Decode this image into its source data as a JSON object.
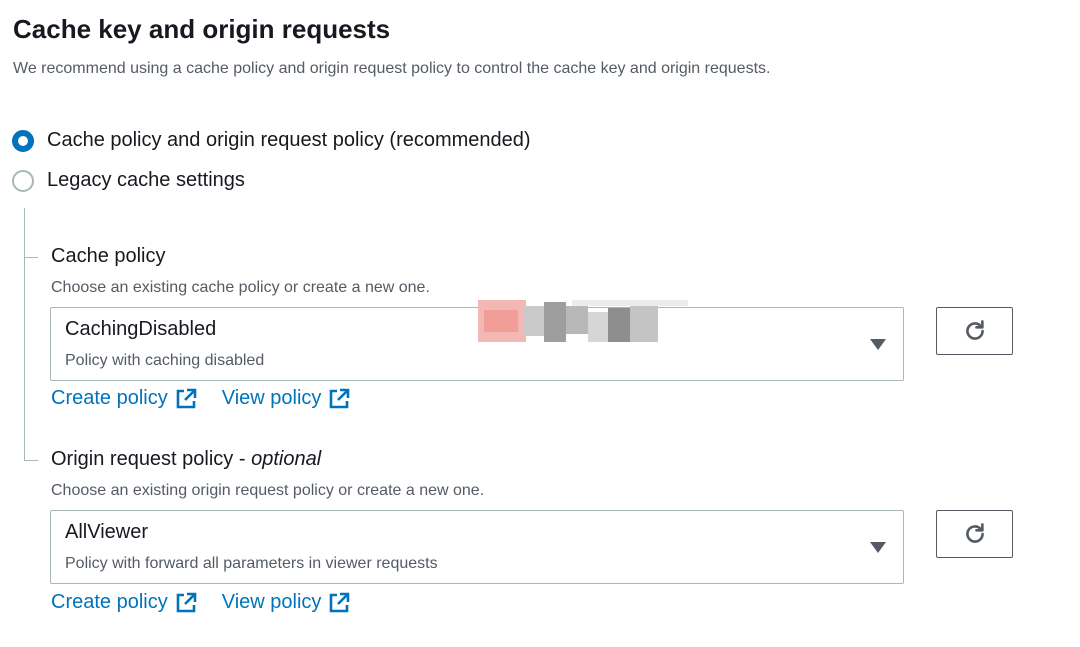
{
  "section": {
    "title": "Cache key and origin requests",
    "description": "We recommend using a cache policy and origin request policy to control the cache key and origin requests."
  },
  "options": [
    {
      "label": "Cache policy and origin request policy (recommended)",
      "checked": true
    },
    {
      "label": "Legacy cache settings",
      "checked": false
    }
  ],
  "cache_policy": {
    "label": "Cache policy",
    "description": "Choose an existing cache policy or create a new one.",
    "selected": "CachingDisabled",
    "selected_description": "Policy with caching disabled",
    "create_link": "Create policy",
    "view_link": "View policy"
  },
  "origin_request_policy": {
    "label": "Origin request policy - ",
    "optional": "optional",
    "description": "Choose an existing origin request policy or create a new one.",
    "selected": "AllViewer",
    "selected_description": "Policy with forward all parameters in viewer requests",
    "create_link": "Create policy",
    "view_link": "View policy"
  },
  "icons": {
    "refresh": "refresh-icon",
    "external": "external-link-icon",
    "caret": "caret-down-icon"
  },
  "colors": {
    "accent": "#0073bb",
    "text": "#16191f",
    "secondary_text": "#545b64",
    "border": "#aab7b8"
  }
}
